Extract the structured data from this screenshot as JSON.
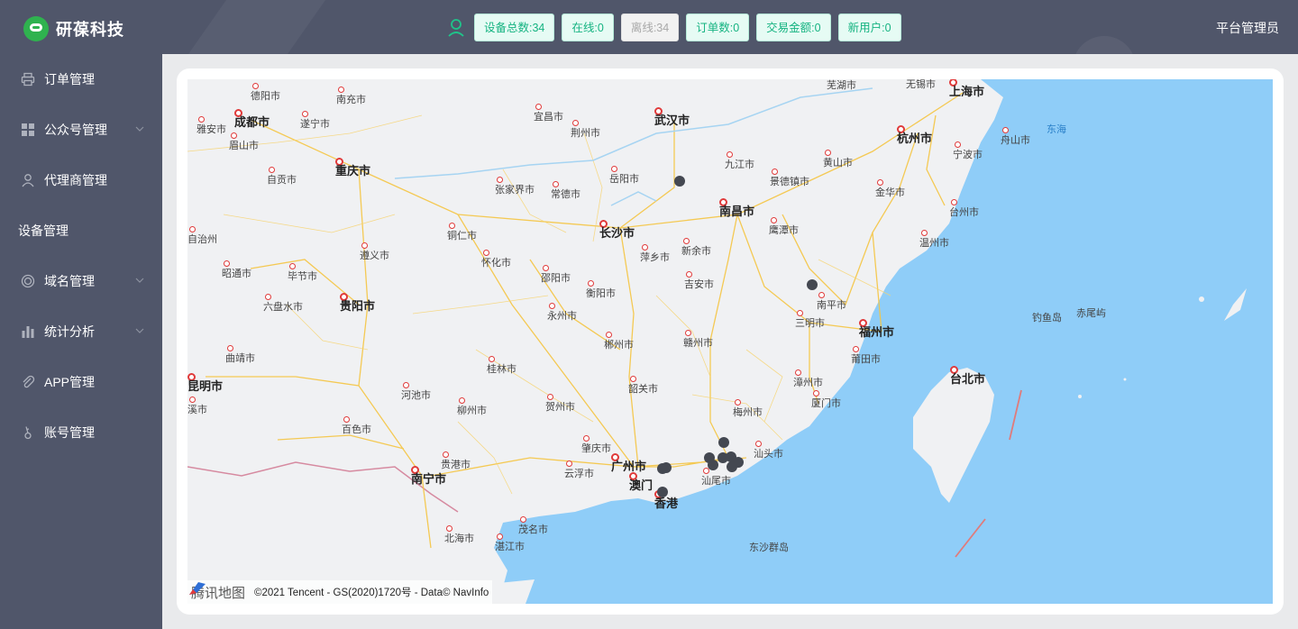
{
  "header": {
    "logo_text": "研葆科技",
    "admin": "平台管理员",
    "stats": [
      {
        "label": "设备总数:34"
      },
      {
        "label": "在线:0"
      },
      {
        "label": "离线:34"
      },
      {
        "label": "订单数:0"
      },
      {
        "label": "交易金额:0"
      },
      {
        "label": "新用户:0"
      }
    ]
  },
  "sidebar": {
    "items": [
      {
        "label": "订单管理",
        "icon": "printer-icon"
      },
      {
        "label": "公众号管理",
        "icon": "grid-icon"
      },
      {
        "label": "代理商管理",
        "icon": "user-icon"
      },
      {
        "label": "设备管理"
      },
      {
        "label": "域名管理",
        "icon": "target-icon"
      },
      {
        "label": "统计分析",
        "icon": "bar-chart-icon"
      },
      {
        "label": "APP管理",
        "icon": "paperclip-icon"
      },
      {
        "label": "账号管理",
        "icon": "key-icon"
      }
    ]
  },
  "map": {
    "cities": [
      {
        "name": "德阳市"
      },
      {
        "name": "南充市"
      },
      {
        "name": "成都市"
      },
      {
        "name": "遂宁市"
      },
      {
        "name": "雅安市"
      },
      {
        "name": "眉山市"
      },
      {
        "name": "宜昌市"
      },
      {
        "name": "荆州市"
      },
      {
        "name": "武汉市"
      },
      {
        "name": "芜湖市"
      },
      {
        "name": "无锡市"
      },
      {
        "name": "上海市"
      },
      {
        "name": "舟山市"
      },
      {
        "name": "杭州市"
      },
      {
        "name": "宁波市"
      },
      {
        "name": "重庆市"
      },
      {
        "name": "自贡市"
      },
      {
        "name": "岳阳市"
      },
      {
        "name": "九江市"
      },
      {
        "name": "黄山市"
      },
      {
        "name": "景德镇市"
      },
      {
        "name": "金华市"
      },
      {
        "name": "张家界市"
      },
      {
        "name": "常德市"
      },
      {
        "name": "南昌市"
      },
      {
        "name": "台州市"
      },
      {
        "name": "长沙市"
      },
      {
        "name": "鹰潭市"
      },
      {
        "name": "温州市"
      },
      {
        "name": "自治州"
      },
      {
        "name": "铜仁市"
      },
      {
        "name": "遵义市"
      },
      {
        "name": "新余市"
      },
      {
        "name": "萍乡市"
      },
      {
        "name": "怀化市"
      },
      {
        "name": "昭通市"
      },
      {
        "name": "毕节市"
      },
      {
        "name": "邵阳市"
      },
      {
        "name": "吉安市"
      },
      {
        "name": "衡阳市"
      },
      {
        "name": "南平市"
      },
      {
        "name": "六盘水市"
      },
      {
        "name": "贵阳市"
      },
      {
        "name": "永州市"
      },
      {
        "name": "三明市"
      },
      {
        "name": "福州市"
      },
      {
        "name": "郴州市"
      },
      {
        "name": "赣州市"
      },
      {
        "name": "曲靖市"
      },
      {
        "name": "莆田市"
      },
      {
        "name": "桂林市"
      },
      {
        "name": "昆明市"
      },
      {
        "name": "韶关市"
      },
      {
        "name": "台北市"
      },
      {
        "name": "河池市"
      },
      {
        "name": "漳州市"
      },
      {
        "name": "溪市"
      },
      {
        "name": "贺州市"
      },
      {
        "name": "柳州市"
      },
      {
        "name": "梅州市"
      },
      {
        "name": "厦门市"
      },
      {
        "name": "百色市"
      },
      {
        "name": "肇庆市"
      },
      {
        "name": "汕头市"
      },
      {
        "name": "广州市"
      },
      {
        "name": "贵港市"
      },
      {
        "name": "云浮市"
      },
      {
        "name": "南宁市"
      },
      {
        "name": "汕尾市"
      },
      {
        "name": "澳门"
      },
      {
        "name": "香港"
      },
      {
        "name": "茂名市"
      },
      {
        "name": "北海市"
      },
      {
        "name": "湛江市"
      }
    ],
    "sea_labels": [
      {
        "name": "东海"
      },
      {
        "name": "钓鱼岛"
      },
      {
        "name": "赤尾屿"
      },
      {
        "name": "东沙群岛"
      }
    ],
    "footer_brand": "腾讯地图",
    "footer_copy": "©2021 Tencent - GS(2020)1720号 - Data© NavInfo"
  }
}
